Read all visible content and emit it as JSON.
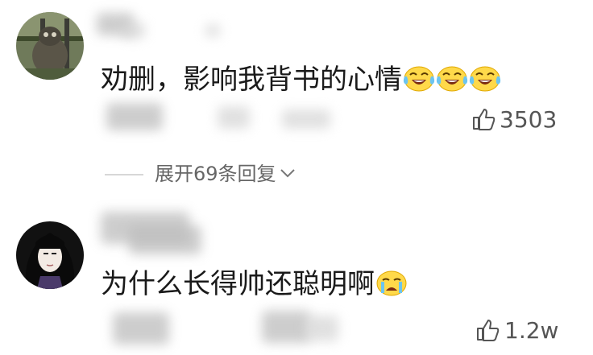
{
  "comments": [
    {
      "text": "劝删，影响我背书的心情",
      "emoji_count": 3,
      "emoji_icon": "laughing-crying-emoji",
      "likes": "3503",
      "replies_label": "展开69条回复"
    },
    {
      "text": "为什么长得帅还聪明啊",
      "emoji_count": 1,
      "emoji_icon": "crying-emoji",
      "likes": "1.2w"
    }
  ],
  "colors": {
    "text": "#1a1a1a",
    "muted": "#666666",
    "emoji_yellow": "#ffd94a",
    "tear_blue": "#6cc4f0"
  }
}
